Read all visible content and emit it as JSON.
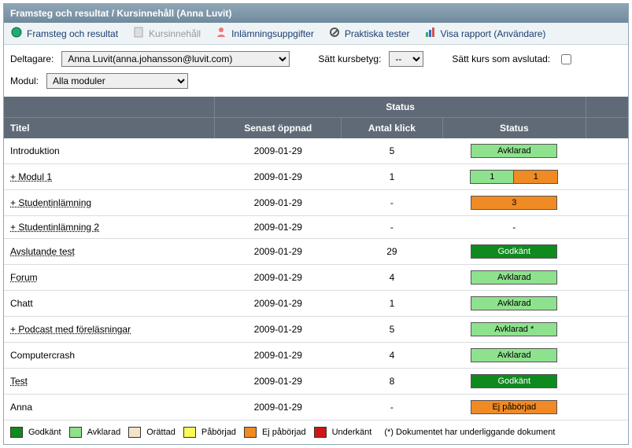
{
  "header": {
    "title": "Framsteg och resultat / Kursinnehåll (Anna Luvit)"
  },
  "toolbar": {
    "items": [
      {
        "label": "Framsteg och resultat",
        "name": "toolbar-progress"
      },
      {
        "label": "Kursinnehåll",
        "name": "toolbar-content",
        "disabled": true
      },
      {
        "label": "Inlämningsuppgifter",
        "name": "toolbar-submissions"
      },
      {
        "label": "Praktiska tester",
        "name": "toolbar-tests"
      },
      {
        "label": "Visa rapport (Användare)",
        "name": "toolbar-report"
      }
    ]
  },
  "filters": {
    "participant_label": "Deltagare:",
    "participant_value": "Anna Luvit(anna.johansson@luvit.com)",
    "grade_label": "Sätt kursbetyg:",
    "grade_value": "--",
    "completed_label": "Sätt kurs som avslutad:",
    "module_label": "Modul:",
    "module_value": "Alla moduler"
  },
  "table": {
    "super_header": "Status",
    "cols": {
      "title": "Titel",
      "opened": "Senast öppnad",
      "clicks": "Antal klick",
      "status": "Status"
    },
    "rows": [
      {
        "title": "Introduktion",
        "link": false,
        "opened": "2009-01-29",
        "clicks": "5",
        "status": {
          "kind": "badge",
          "class": "c-avklarad",
          "text": "Avklarad"
        }
      },
      {
        "title": "+ Modul 1",
        "link": true,
        "opened": "2009-01-29",
        "clicks": "1",
        "status": {
          "kind": "split",
          "a": "1",
          "b": "1"
        }
      },
      {
        "title": "+ Studentinlämning",
        "link": true,
        "opened": "2009-01-29",
        "clicks": "-",
        "status": {
          "kind": "badge",
          "class": "c-ejpaborjad",
          "text": "3"
        }
      },
      {
        "title": "+ Studentinlämning 2",
        "link": true,
        "opened": "2009-01-29",
        "clicks": "-",
        "status": {
          "kind": "text",
          "text": "-"
        }
      },
      {
        "title": "Avslutande test",
        "link": true,
        "opened": "2009-01-29",
        "clicks": "29",
        "status": {
          "kind": "badge",
          "class": "c-godkant",
          "text": "Godkänt"
        }
      },
      {
        "title": "Forum",
        "link": true,
        "opened": "2009-01-29",
        "clicks": "4",
        "status": {
          "kind": "badge",
          "class": "c-avklarad",
          "text": "Avklarad"
        }
      },
      {
        "title": "Chatt",
        "link": false,
        "opened": "2009-01-29",
        "clicks": "1",
        "status": {
          "kind": "badge",
          "class": "c-avklarad",
          "text": "Avklarad"
        }
      },
      {
        "title": "+ Podcast med föreläsningar",
        "link": true,
        "opened": "2009-01-29",
        "clicks": "5",
        "status": {
          "kind": "badge",
          "class": "c-avklarad",
          "text": "Avklarad *"
        }
      },
      {
        "title": "Computercrash",
        "link": false,
        "opened": "2009-01-29",
        "clicks": "4",
        "status": {
          "kind": "badge",
          "class": "c-avklarad",
          "text": "Avklarad"
        }
      },
      {
        "title": "Test",
        "link": true,
        "opened": "2009-01-29",
        "clicks": "8",
        "status": {
          "kind": "badge",
          "class": "c-godkant",
          "text": "Godkänt"
        }
      },
      {
        "title": "Anna",
        "link": false,
        "opened": "2009-01-29",
        "clicks": "-",
        "status": {
          "kind": "badge",
          "class": "c-ejpaborjad",
          "text": "Ej påbörjad"
        }
      }
    ]
  },
  "legend": {
    "items": [
      {
        "class": "c-godkant",
        "label": "Godkänt"
      },
      {
        "class": "c-avklarad",
        "label": "Avklarad"
      },
      {
        "class": "c-orattad",
        "label": "Orättad"
      },
      {
        "class": "c-paborjad",
        "label": "Påbörjad"
      },
      {
        "class": "c-ejpaborjad",
        "label": "Ej påbörjad"
      },
      {
        "class": "c-underkant",
        "label": "Underkänt"
      }
    ],
    "note": "(*)  Dokumentet har underliggande dokument"
  }
}
